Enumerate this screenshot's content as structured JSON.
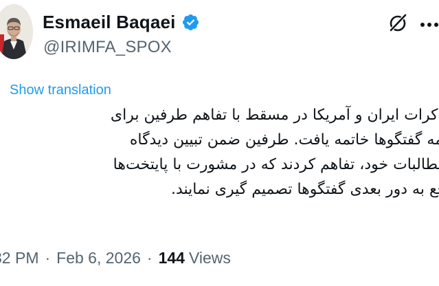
{
  "author": {
    "display_name": "Esmaeil Baqaei",
    "handle": "@IRIMFA_SPOX",
    "verified": true
  },
  "actions": {
    "grok_icon": "grok-icon",
    "more_icon": "more-icon"
  },
  "translation": {
    "link_label": "Show translation"
  },
  "tweet": {
    "lines": [
      "مذاکرات ایران و آمریکا در مسقط با تفاهم طرفین برای",
      "ادامه گفتگوها خاتمه یافت. طرفین ضمن تبیین دیدگاه‌",
      "و مطالبات خود، تفاهم کردند که در مشورت با پایتخت‌ها",
      "راجع به دور بعدی گفتگوها تصمیم گیری نمایند."
    ]
  },
  "meta": {
    "time": "32 PM",
    "separator": "·",
    "date": "Feb 6, 2026",
    "views_count": "144",
    "views_label": "Views"
  },
  "colors": {
    "text": "#0f1419",
    "secondary": "#536471",
    "link": "#1d9bf0",
    "verified_badge": "#1d9bf0"
  }
}
